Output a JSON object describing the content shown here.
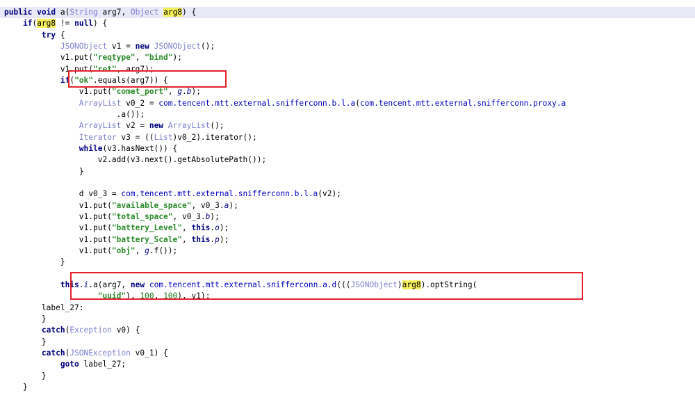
{
  "code": {
    "lines": [
      [
        {
          "t": "public",
          "c": "kw"
        },
        {
          "t": " "
        },
        {
          "t": "void",
          "c": "kw"
        },
        {
          "t": " a("
        },
        {
          "t": "String",
          "c": "ty"
        },
        {
          "t": " arg7, "
        },
        {
          "t": "Object",
          "c": "ty"
        },
        {
          "t": " "
        },
        {
          "t": "arg8",
          "c": "mk"
        },
        {
          "t": ") {"
        }
      ],
      [
        {
          "t": "    "
        },
        {
          "t": "if",
          "c": "kw"
        },
        {
          "t": "("
        },
        {
          "t": "arg8",
          "c": "mk"
        },
        {
          "t": " != "
        },
        {
          "t": "null",
          "c": "kw"
        },
        {
          "t": ") {"
        }
      ],
      [
        {
          "t": "        "
        },
        {
          "t": "try",
          "c": "kw"
        },
        {
          "t": " {"
        }
      ],
      [
        {
          "t": "            "
        },
        {
          "t": "JSONObject",
          "c": "ty"
        },
        {
          "t": " v1 = "
        },
        {
          "t": "new",
          "c": "kw"
        },
        {
          "t": " "
        },
        {
          "t": "JSONObject",
          "c": "ty"
        },
        {
          "t": "();"
        }
      ],
      [
        {
          "t": "            v1.put("
        },
        {
          "t": "\"reqtype\"",
          "c": "str"
        },
        {
          "t": ", "
        },
        {
          "t": "\"bind\"",
          "c": "str"
        },
        {
          "t": ");"
        }
      ],
      [
        {
          "t": "            v1.put("
        },
        {
          "t": "\"ret\"",
          "c": "str"
        },
        {
          "t": ", arg7);"
        }
      ],
      [
        {
          "t": "            "
        },
        {
          "t": "if",
          "c": "kw"
        },
        {
          "t": "("
        },
        {
          "t": "\"ok\"",
          "c": "str"
        },
        {
          "t": ".equals(arg7)) {"
        }
      ],
      [
        {
          "t": "                v1.put("
        },
        {
          "t": "\"comet_port\"",
          "c": "str"
        },
        {
          "t": ", "
        },
        {
          "t": "g",
          "c": "fld"
        },
        {
          "t": "."
        },
        {
          "t": "b",
          "c": "fld"
        },
        {
          "t": ");"
        }
      ],
      [
        {
          "t": "                "
        },
        {
          "t": "ArrayList",
          "c": "ty"
        },
        {
          "t": " v0_2 = "
        },
        {
          "t": "com.tencent.mtt.external.snifferconn.b.l.a",
          "c": "pkg"
        },
        {
          "t": "("
        },
        {
          "t": "com.tencent.mtt.external.snifferconn.proxy.a",
          "c": "pkg"
        }
      ],
      [
        {
          "t": "                        .a());"
        }
      ],
      [
        {
          "t": "                "
        },
        {
          "t": "ArrayList",
          "c": "ty"
        },
        {
          "t": " v2 = "
        },
        {
          "t": "new",
          "c": "kw"
        },
        {
          "t": " "
        },
        {
          "t": "ArrayList",
          "c": "ty"
        },
        {
          "t": "();"
        }
      ],
      [
        {
          "t": "                "
        },
        {
          "t": "Iterator",
          "c": "ty"
        },
        {
          "t": " v3 = (("
        },
        {
          "t": "List",
          "c": "ty"
        },
        {
          "t": ")v0_2).iterator();"
        }
      ],
      [
        {
          "t": "                "
        },
        {
          "t": "while",
          "c": "kw"
        },
        {
          "t": "(v3.hasNext()) {"
        }
      ],
      [
        {
          "t": "                    v2.add(v3.next().getAbsolutePath());"
        }
      ],
      [
        {
          "t": "                }"
        }
      ],
      [
        {
          "t": ""
        }
      ],
      [
        {
          "t": "                d v0_3 = "
        },
        {
          "t": "com.tencent.mtt.external.snifferconn.b.l.a",
          "c": "pkg"
        },
        {
          "t": "(v2);"
        }
      ],
      [
        {
          "t": "                v1.put("
        },
        {
          "t": "\"available_space\"",
          "c": "str"
        },
        {
          "t": ", v0_3."
        },
        {
          "t": "a",
          "c": "fld"
        },
        {
          "t": ");"
        }
      ],
      [
        {
          "t": "                v1.put("
        },
        {
          "t": "\"total_space\"",
          "c": "str"
        },
        {
          "t": ", v0_3."
        },
        {
          "t": "b",
          "c": "fld"
        },
        {
          "t": ");"
        }
      ],
      [
        {
          "t": "                v1.put("
        },
        {
          "t": "\"battery_Level\"",
          "c": "str"
        },
        {
          "t": ", "
        },
        {
          "t": "this",
          "c": "kw"
        },
        {
          "t": "."
        },
        {
          "t": "o",
          "c": "fld"
        },
        {
          "t": ");"
        }
      ],
      [
        {
          "t": "                v1.put("
        },
        {
          "t": "\"battery_Scale\"",
          "c": "str"
        },
        {
          "t": ", "
        },
        {
          "t": "this",
          "c": "kw"
        },
        {
          "t": "."
        },
        {
          "t": "p",
          "c": "fld"
        },
        {
          "t": ");"
        }
      ],
      [
        {
          "t": "                v1.put("
        },
        {
          "t": "\"obj\"",
          "c": "str"
        },
        {
          "t": ", "
        },
        {
          "t": "g",
          "c": "fld"
        },
        {
          "t": ".f());"
        }
      ],
      [
        {
          "t": "            }"
        }
      ],
      [
        {
          "t": ""
        }
      ],
      [
        {
          "t": "            "
        },
        {
          "t": "this",
          "c": "kw"
        },
        {
          "t": "."
        },
        {
          "t": "i",
          "c": "fld"
        },
        {
          "t": ".a(arg7, "
        },
        {
          "t": "new",
          "c": "kw"
        },
        {
          "t": " "
        },
        {
          "t": "com.tencent.mtt.external.snifferconn.a.d",
          "c": "pkg"
        },
        {
          "t": "((("
        },
        {
          "t": "JSONObject",
          "c": "ty"
        },
        {
          "t": ")"
        },
        {
          "t": "arg8",
          "c": "mk"
        },
        {
          "t": ").optString("
        }
      ],
      [
        {
          "t": "                    "
        },
        {
          "t": "\"uuid\"",
          "c": "str"
        },
        {
          "t": "), "
        },
        {
          "t": "100",
          "c": "num"
        },
        {
          "t": ", "
        },
        {
          "t": "100",
          "c": "num"
        },
        {
          "t": "), v1);"
        }
      ],
      [
        {
          "t": "        label_27:"
        }
      ],
      [
        {
          "t": "        }"
        }
      ],
      [
        {
          "t": "        "
        },
        {
          "t": "catch",
          "c": "kw"
        },
        {
          "t": "("
        },
        {
          "t": "Exception",
          "c": "ty"
        },
        {
          "t": " v0) {"
        }
      ],
      [
        {
          "t": "        }"
        }
      ],
      [
        {
          "t": "        "
        },
        {
          "t": "catch",
          "c": "kw"
        },
        {
          "t": "("
        },
        {
          "t": "JSONException",
          "c": "ty"
        },
        {
          "t": " v0_1) {"
        }
      ],
      [
        {
          "t": "            "
        },
        {
          "t": "goto",
          "c": "kw"
        },
        {
          "t": " label_27;"
        }
      ],
      [
        {
          "t": "        }"
        }
      ],
      [
        {
          "t": "    }"
        }
      ]
    ]
  }
}
